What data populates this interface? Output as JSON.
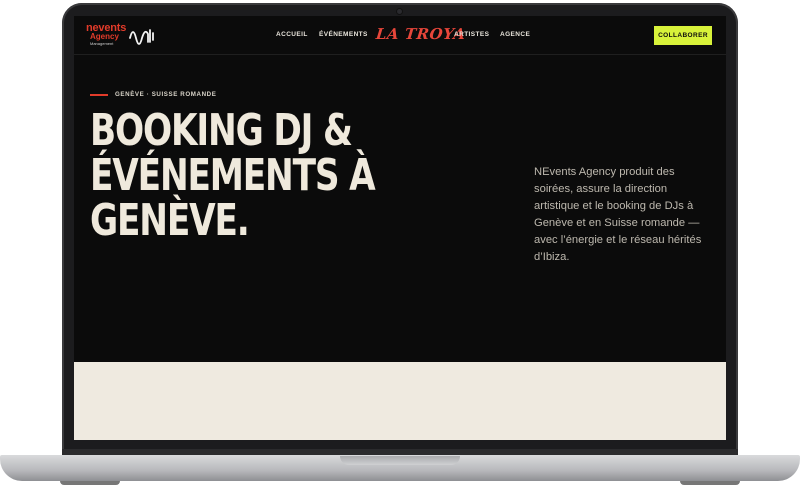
{
  "nav": {
    "logo": {
      "line1": "nevents",
      "line2": "Agency",
      "line3": "Management"
    },
    "links": [
      "ACCUEIL",
      "ÉVÉNEMENTS",
      "ARTISTES",
      "AGENCE"
    ],
    "center_brand": "LA TROYA",
    "cta_label": "COLLABORER"
  },
  "hero": {
    "eyebrow": "GENÈVE · SUISSE ROMANDE",
    "headline_lines": [
      "BOOKING DJ &",
      "ÉVÉNEMENTS À",
      "GENÈVE."
    ],
    "description": "NEvents Agency produit des soirées, assure la direction artistique et le booking de DJs à Genève et en Suisse romande — avec l’énergie et le réseau hérités d’Ibiza."
  },
  "colors": {
    "accent_red": "#e23b2a",
    "cta_lime": "#d8f23a",
    "background_dark": "#0b0b0b",
    "headline_cream": "#efe9dc",
    "section_cream": "#efeae0"
  },
  "icons": {
    "logo_mark": "sound-wave-icon"
  }
}
